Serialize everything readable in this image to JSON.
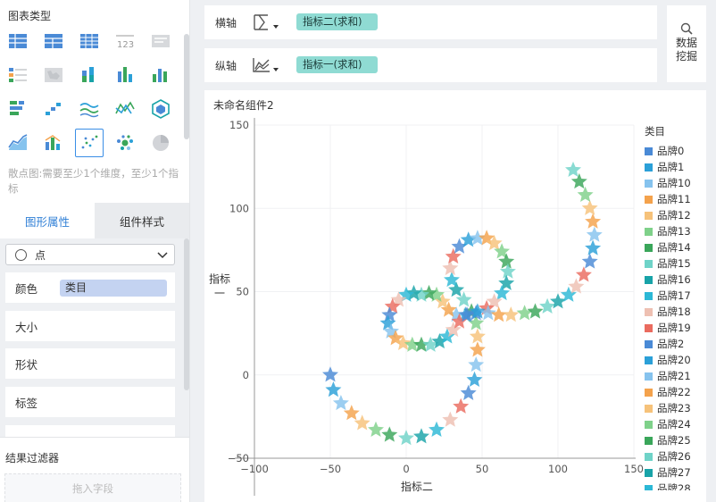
{
  "left_panel": {
    "chart_type_title": "图表类型",
    "hint": "散点图:需要至少1个维度，至少1个指标",
    "tabs": [
      {
        "label": "图形属性"
      },
      {
        "label": "组件样式"
      }
    ],
    "shape_select": {
      "value": "点"
    },
    "prop_rows": [
      {
        "label": "颜色",
        "value": "类目"
      },
      {
        "label": "大小"
      },
      {
        "label": "形状"
      },
      {
        "label": "标签"
      }
    ],
    "filter_title": "结果过滤器",
    "filter_drop_placeholder": "拖入字段",
    "chart_types": [
      "grouped-table-icon",
      "crosstab-icon",
      "detail-table-icon",
      "kpi-number-icon",
      "text-card-icon",
      "legend-list-icon",
      "map-icon",
      "stacked-bar-icon",
      "column-chart-icon",
      "bar-chart-icon",
      "range-bar-icon",
      "step-chart-icon",
      "wave-line-icon",
      "radar-line-icon",
      "funnel-icon",
      "area-line-icon",
      "combo-chart-icon",
      "scatter-icon",
      "bubble-icon",
      "pie-icon"
    ],
    "selected_chart_type": "scatter-icon"
  },
  "x_axis": {
    "label": "横轴",
    "field": "指标二(求和)"
  },
  "y_axis": {
    "label": "纵轴",
    "field": "指标一(求和)"
  },
  "data_mining": {
    "line1": "数据",
    "line2": "挖掘"
  },
  "component": {
    "title": "未命名组件2"
  },
  "legend": {
    "title": "类目",
    "items": [
      {
        "name": "品牌0",
        "color": "#4a8ad6"
      },
      {
        "name": "品牌1",
        "color": "#2ba0d8"
      },
      {
        "name": "品牌10",
        "color": "#86c3ee"
      },
      {
        "name": "品牌11",
        "color": "#f4a24c"
      },
      {
        "name": "品牌12",
        "color": "#f6c27a"
      },
      {
        "name": "品牌13",
        "color": "#7fd18a"
      },
      {
        "name": "品牌14",
        "color": "#3aa65a"
      },
      {
        "name": "品牌15",
        "color": "#6fd3c8"
      },
      {
        "name": "品牌16",
        "color": "#18a3a8"
      },
      {
        "name": "品牌17",
        "color": "#2cb8d6"
      },
      {
        "name": "品牌18",
        "color": "#eec0b2"
      },
      {
        "name": "品牌19",
        "color": "#ea6b5f"
      },
      {
        "name": "品牌2",
        "color": "#4a8ad6"
      },
      {
        "name": "品牌20",
        "color": "#2ba0d8"
      },
      {
        "name": "品牌21",
        "color": "#86c3ee"
      },
      {
        "name": "品牌22",
        "color": "#f4a24c"
      },
      {
        "name": "品牌23",
        "color": "#f6c27a"
      },
      {
        "name": "品牌24",
        "color": "#7fd18a"
      },
      {
        "name": "品牌25",
        "color": "#3aa65a"
      },
      {
        "name": "品牌26",
        "color": "#6fd3c8"
      },
      {
        "name": "品牌27",
        "color": "#18a3a8"
      },
      {
        "name": "品牌28",
        "color": "#2cb8d6"
      }
    ]
  },
  "chart_data": {
    "type": "scatter",
    "marker": "star",
    "xlabel": "指标二",
    "ylabel": "指标一",
    "xlim": [
      -100,
      150
    ],
    "ylim": [
      -50,
      150
    ],
    "xticks": [
      "−100",
      "−50",
      "0",
      "50",
      "100",
      "150"
    ],
    "yticks": [
      "−50",
      "0",
      "50",
      "100",
      "150"
    ],
    "grid": true,
    "legend_position": "right",
    "color_cycle": [
      "#4a8ad6",
      "#2ba0d8",
      "#86c3ee",
      "#f4a24c",
      "#f6c27a",
      "#7fd18a",
      "#3aa65a",
      "#6fd3c8",
      "#18a3a8",
      "#2cb8d6",
      "#eec0b2",
      "#ea6b5f"
    ],
    "points": [
      [
        -50,
        0
      ],
      [
        -48,
        -9
      ],
      [
        -43,
        -17
      ],
      [
        -36,
        -23
      ],
      [
        -29,
        -29
      ],
      [
        -20,
        -33
      ],
      [
        -11,
        -36
      ],
      [
        0,
        -38
      ],
      [
        10,
        -37
      ],
      [
        20,
        -33
      ],
      [
        29,
        -27
      ],
      [
        36,
        -19
      ],
      [
        41,
        -11
      ],
      [
        45,
        -3
      ],
      [
        46,
        6
      ],
      [
        47,
        15
      ],
      [
        47,
        23
      ],
      [
        46,
        31
      ],
      [
        43,
        38
      ],
      [
        38,
        45
      ],
      [
        33,
        51
      ],
      [
        30,
        57
      ],
      [
        29,
        64
      ],
      [
        31,
        71
      ],
      [
        35,
        77
      ],
      [
        41,
        81
      ],
      [
        47,
        82
      ],
      [
        53,
        82
      ],
      [
        58,
        79
      ],
      [
        63,
        74
      ],
      [
        66,
        68
      ],
      [
        67,
        62
      ],
      [
        66,
        55
      ],
      [
        63,
        49
      ],
      [
        58,
        44
      ],
      [
        53,
        40
      ],
      [
        46,
        37
      ],
      [
        39,
        36
      ],
      [
        33,
        36
      ],
      [
        28,
        39
      ],
      [
        24,
        44
      ],
      [
        20,
        48
      ],
      [
        15,
        49
      ],
      [
        10,
        48
      ],
      [
        5,
        49
      ],
      [
        0,
        48
      ],
      [
        -5,
        45
      ],
      [
        -9,
        41
      ],
      [
        -11,
        36
      ],
      [
        -12,
        31
      ],
      [
        -10,
        26
      ],
      [
        -7,
        22
      ],
      [
        -2,
        19
      ],
      [
        4,
        18
      ],
      [
        10,
        18
      ],
      [
        16,
        18
      ],
      [
        22,
        20
      ],
      [
        27,
        23
      ],
      [
        31,
        27
      ],
      [
        35,
        32
      ],
      [
        40,
        36
      ],
      [
        47,
        38
      ],
      [
        54,
        37
      ],
      [
        61,
        36
      ],
      [
        69,
        36
      ],
      [
        78,
        37
      ],
      [
        85,
        38
      ],
      [
        93,
        41
      ],
      [
        100,
        44
      ],
      [
        107,
        48
      ],
      [
        112,
        53
      ],
      [
        117,
        60
      ],
      [
        121,
        68
      ],
      [
        123,
        76
      ],
      [
        124,
        84
      ],
      [
        123,
        92
      ],
      [
        121,
        100
      ],
      [
        118,
        108
      ],
      [
        114,
        116
      ],
      [
        110,
        123
      ]
    ]
  }
}
